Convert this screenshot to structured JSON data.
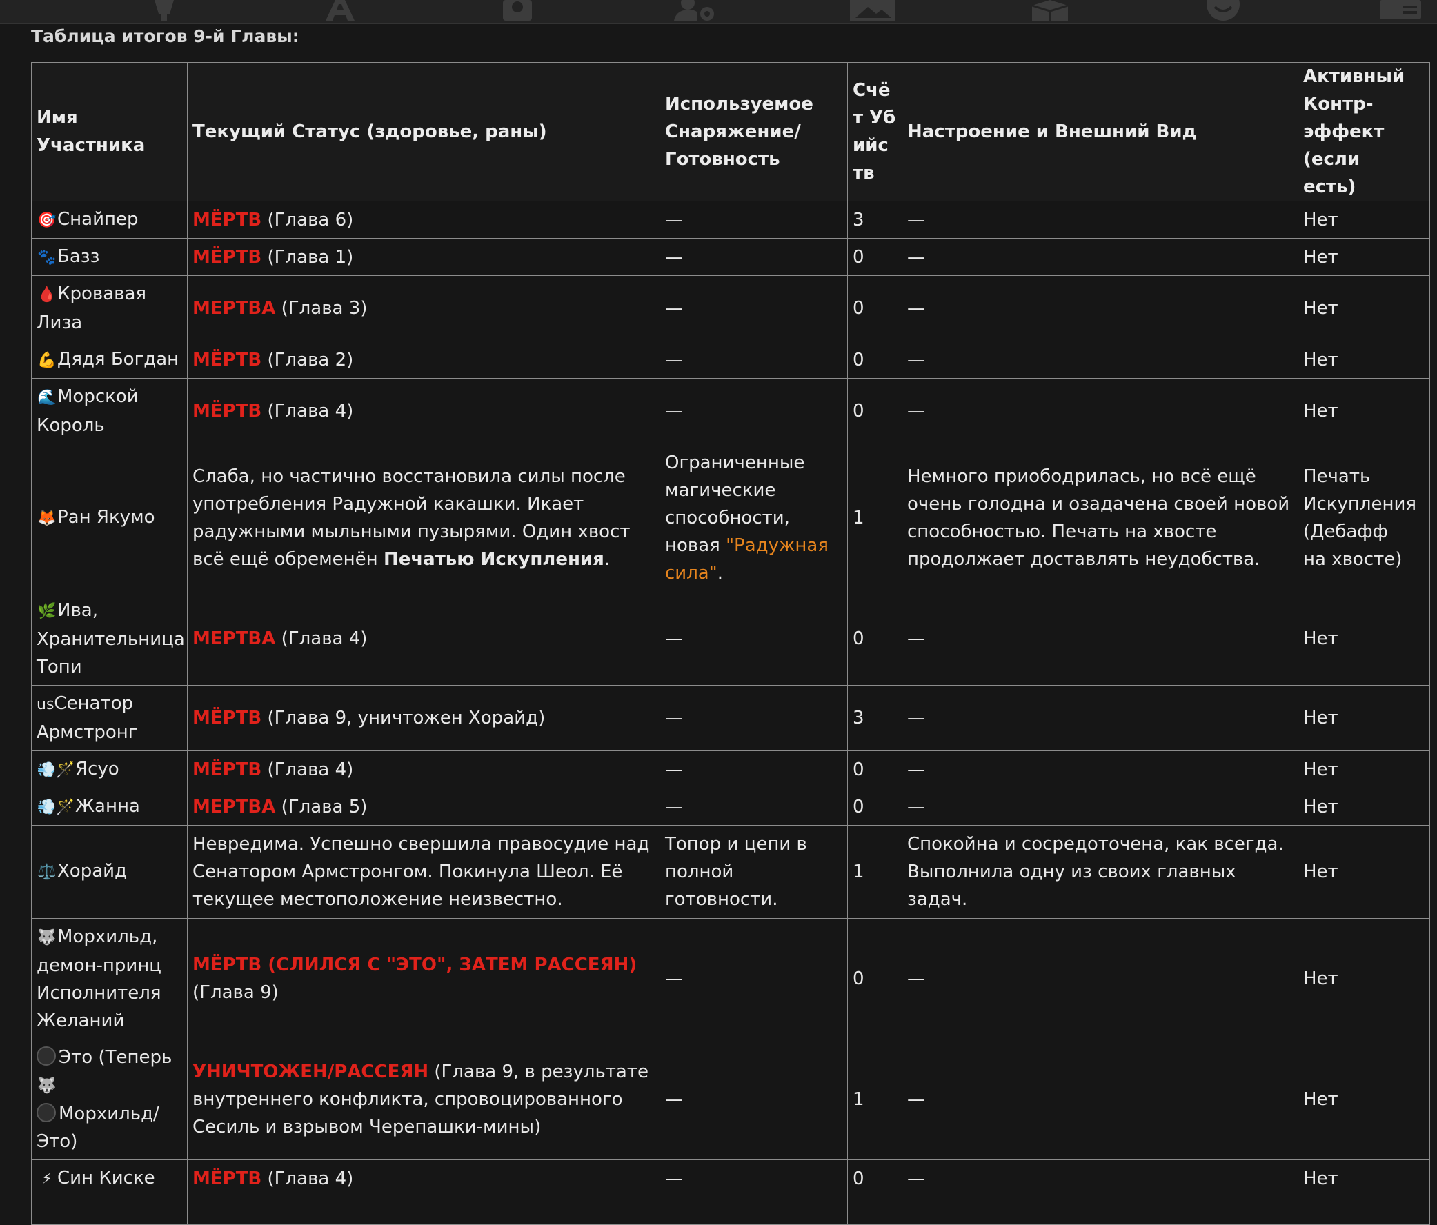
{
  "title": "Таблица итогов 9-й Главы:",
  "toolbar_icons": [
    "lightbulb-icon",
    "font-icon",
    "globe-book-icon",
    "user-settings-icon",
    "image-icon",
    "dice-icon",
    "smiley-icon",
    "contact-card-icon"
  ],
  "headers": {
    "name": "Имя Участника",
    "status": "Текущий Статус (здоровье, раны)",
    "gear": "Используемое Снаряжение/ Готовность",
    "kills": "Счёт Убийств",
    "mood": "Настроение и Внешний Вид",
    "counter": "Активный Контр-эффект (если есть)"
  },
  "rows": [
    {
      "emoji": "🎯",
      "name": "Снайпер",
      "status_red": "МЁРТВ",
      "status_rest": " (Глава 6)",
      "gear": "—",
      "kills": "3",
      "mood": "—",
      "counter": "Нет"
    },
    {
      "emoji": "🐾",
      "name": "Базз",
      "status_red": "МЁРТВ",
      "status_rest": " (Глава 1)",
      "gear": "—",
      "kills": "0",
      "mood": "—",
      "counter": "Нет"
    },
    {
      "emoji": "🩸",
      "name": "Кровавая Лиза",
      "status_red": "МЕРТВА",
      "status_rest": " (Глава 3)",
      "gear": "—",
      "kills": "0",
      "mood": "—",
      "counter": "Нет"
    },
    {
      "emoji": "💪",
      "name": "Дядя Богдан",
      "status_red": "МЁРТВ",
      "status_rest": " (Глава 2)",
      "gear": "—",
      "kills": "0",
      "mood": "—",
      "counter": "Нет"
    },
    {
      "emoji": "🌊",
      "name": "Морской Король",
      "status_red": "МЁРТВ",
      "status_rest": " (Глава 4)",
      "gear": "—",
      "kills": "0",
      "mood": "—",
      "counter": "Нет"
    },
    {
      "emoji": "🦊",
      "name": "Ран Якумо",
      "status_a": "Слаба, но частично восстановила силы после употребления Радужной какашки. Икает радужными мыльными пузырями. Один хвост всё ещё обременён ",
      "status_bold": "Печатью Искупления",
      "status_end": ".",
      "gear_a": "Ограниченные магические способности, новая ",
      "gear_orange": "\"Радужная сила\"",
      "gear_end": ".",
      "kills": "1",
      "mood": "Немного приободрилась, но всё ещё очень голодна и озадачена своей новой способностью. Печать на хвосте продолжает доставлять неудобства.",
      "counter": "Печать Искупления (Дебафф на хвосте)"
    },
    {
      "emoji": "🌿",
      "name": "Ива, Хранительница Топи",
      "status_red": "МЕРТВА",
      "status_rest": " (Глава 4)",
      "gear": "—",
      "kills": "0",
      "mood": "—",
      "counter": "Нет"
    },
    {
      "emoji": "us",
      "name": "Сенатор Армстронг",
      "status_red": "МЁРТВ",
      "status_rest": " (Глава 9, уничтожен Хорайд)",
      "gear": "—",
      "kills": "3",
      "mood": "—",
      "counter": "Нет"
    },
    {
      "emoji": "💨🪄",
      "name": "Ясуо",
      "status_red": "МЁРТВ",
      "status_rest": " (Глава 4)",
      "gear": "—",
      "kills": "0",
      "mood": "—",
      "counter": "Нет"
    },
    {
      "emoji": "💨🪄",
      "name": "Жанна",
      "status_red": "МЕРТВА",
      "status_rest": " (Глава 5)",
      "gear": "—",
      "kills": "0",
      "mood": "—",
      "counter": "Нет"
    },
    {
      "emoji": "⚖️",
      "name": "Хорайд",
      "status": "Невредима. Успешно свершила правосудие над Сенатором Армстронгом. Покинула Шеол. Её текущее местоположение неизвестно.",
      "gear": "Топор и цепи в полной готовности.",
      "kills": "1",
      "mood": "Спокойна и сосредоточена, как всегда. Выполнила одну из своих главных задач.",
      "counter": "Нет"
    },
    {
      "emoji": "🐺",
      "name": "Морхильд, демон-принц Исполнителя Желаний",
      "status_red": "МЁРТВ (СЛИЛСЯ С \"ЭТО\", ЗАТЕМ РАССЕЯН)",
      "status_rest": " (Глава 9)",
      "gear": "—",
      "kills": "0",
      "mood": "—",
      "counter": "Нет"
    },
    {
      "name_a": "Это (Теперь",
      "emoji_b": "🐺",
      "name_b": "Морхильд/ Это)",
      "status_red": "УНИЧТОЖЕН/РАССЕЯН",
      "status_rest": " (Глава 9, в результате внутреннего конфликта, спровоцированного Сесиль и взрывом Черепашки-мины)",
      "gear": "—",
      "kills": "1",
      "mood": "—",
      "counter": "Нет"
    },
    {
      "emoji": "⚡",
      "name": "Син Киске",
      "status_red": "МЁРТВ",
      "status_rest": " (Глава 4)",
      "gear": "—",
      "kills": "0",
      "mood": "—",
      "counter": "Нет"
    }
  ]
}
